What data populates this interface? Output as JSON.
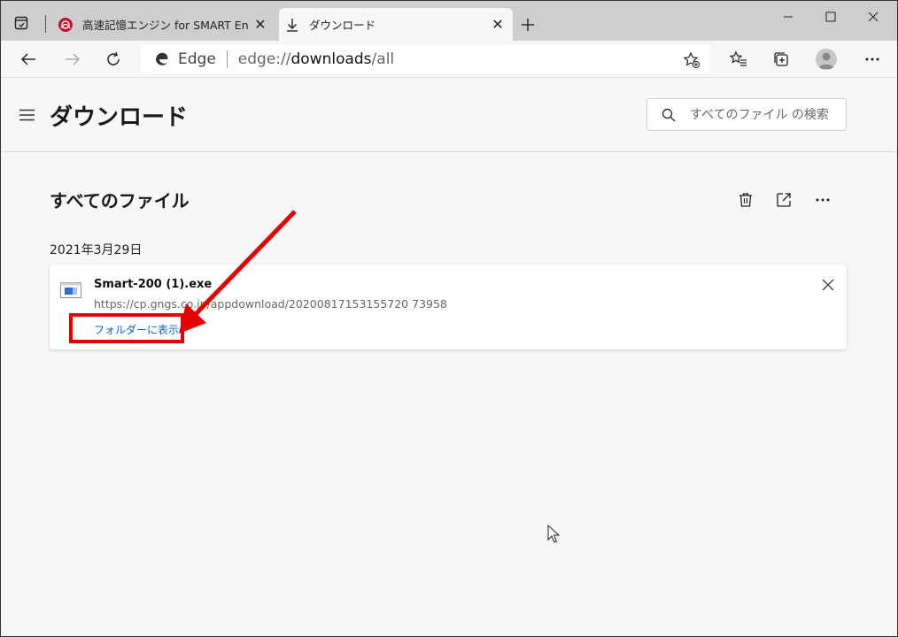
{
  "tabs": [
    {
      "title": "高速記憶エンジン for SMART English",
      "favicon": "red-logo-icon",
      "active": false
    },
    {
      "title": "ダウンロード",
      "favicon": "download-icon",
      "active": true
    }
  ],
  "address": {
    "edge_label": "Edge",
    "url_scheme": "edge://",
    "url_host": "downloads",
    "url_path": "/all"
  },
  "page": {
    "title": "ダウンロード",
    "search_placeholder": "すべてのファイル の検索",
    "section_title": "すべてのファイル"
  },
  "downloads": [
    {
      "date": "2021年3月29日",
      "file_name": "Smart-200 (1).exe",
      "url": "https://cp.gngs.co.jp/appdownload/20200817153155720 73958",
      "action": "フォルダーに表示"
    }
  ],
  "colors": {
    "link": "#0a63c9",
    "annotation": "#e60000"
  }
}
